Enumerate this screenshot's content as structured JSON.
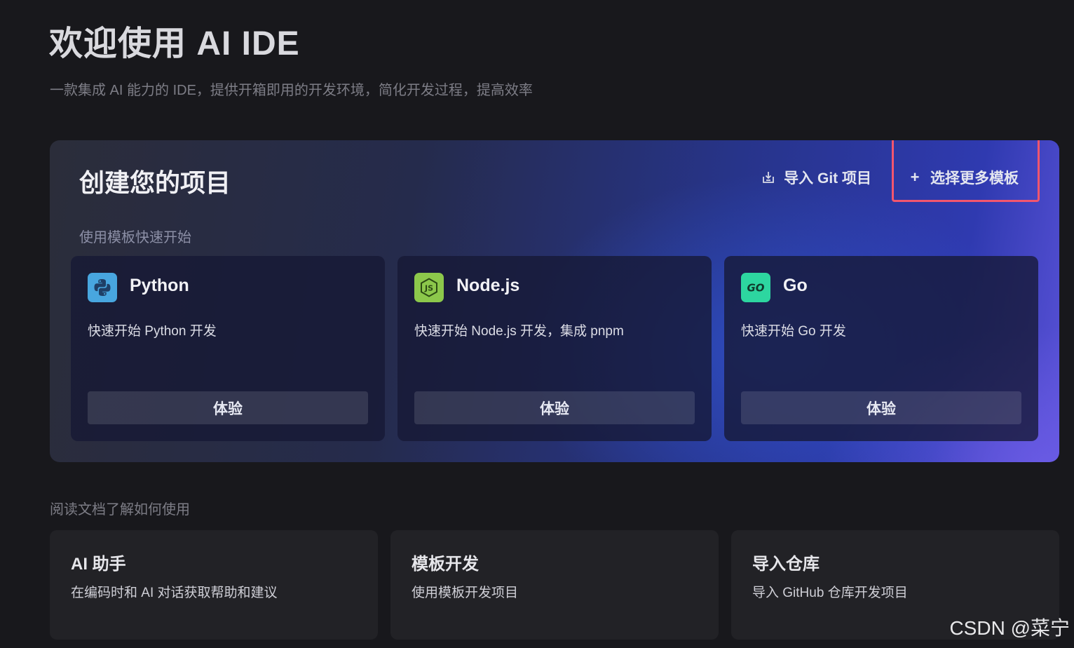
{
  "header": {
    "title": "欢迎使用 AI IDE",
    "subtitle": "一款集成 AI 能力的 IDE，提供开箱即用的开发环境，简化开发过程，提高效率"
  },
  "create": {
    "title": "创建您的项目",
    "import_git_label": "导入 Git 项目",
    "import_git_icon": "import-icon",
    "more_templates_label": "选择更多模板",
    "more_templates_icon": "plus-icon",
    "highlight_color": "#f2566e",
    "subtitle": "使用模板快速开始",
    "templates": [
      {
        "name": "Python",
        "desc": "快速开始 Python 开发",
        "button": "体验",
        "icon": "python-icon",
        "icon_color": "#4aa8e0"
      },
      {
        "name": "Node.js",
        "desc": "快速开始 Node.js 开发，集成 pnpm",
        "button": "体验",
        "icon": "nodejs-icon",
        "icon_color": "#8cc84b"
      },
      {
        "name": "Go",
        "desc": "快速开始 Go 开发",
        "button": "体验",
        "icon": "go-icon",
        "icon_color": "#2dd6a0"
      }
    ]
  },
  "docs": {
    "heading": "阅读文档了解如何使用",
    "cards": [
      {
        "title": "AI 助手",
        "desc": "在编码时和 AI 对话获取帮助和建议"
      },
      {
        "title": "模板开发",
        "desc": "使用模板开发项目"
      },
      {
        "title": "导入仓库",
        "desc": "导入 GitHub 仓库开发项目"
      }
    ]
  },
  "watermark": "CSDN @菜宁"
}
